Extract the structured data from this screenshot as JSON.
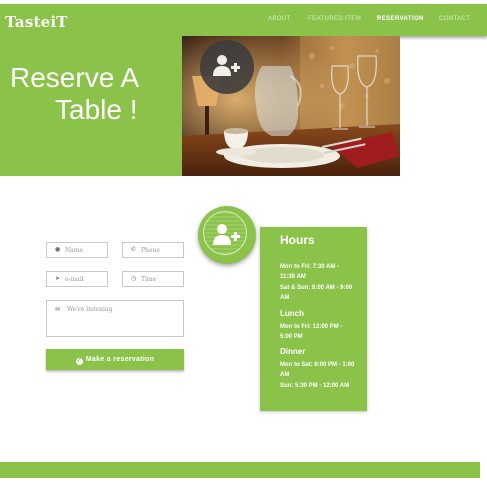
{
  "nav": {
    "brand": "TasteiT",
    "links": [
      "ABOUT",
      "FEATURED ITEM",
      "RESERVATION",
      "CONTACT"
    ]
  },
  "hero": {
    "line1": "Reserve A",
    "line2": "Table !"
  },
  "form": {
    "name_placeholder": "Name",
    "phone_placeholder": "Phone",
    "email_placeholder": "e-mail",
    "time_placeholder": "Time",
    "message_placeholder": "We're listening",
    "submit_label": "Make a reservation"
  },
  "hours": {
    "title": "Hours",
    "general_weekday": "Mon to Fri: 7:30 AM - 11:30 AM",
    "general_weekend": "Sat & Sun: 8:00 AM - 9:00 AM",
    "lunch_title": "Lunch",
    "lunch_times": "Mon to Fri: 12:00 PM - 5:00 PM",
    "dinner_title": "Dinner",
    "dinner_weekday": "Mon to Sat: 6:00 PM - 1:00 AM",
    "dinner_sunday": "Sun: 5:30 PM - 12:00 AM"
  },
  "colors": {
    "accent": "#8bc34a",
    "nav_link": "#dcedc8",
    "badge_dark": "#3c3c3c"
  },
  "icons": [
    "user-plus-icon",
    "user-icon",
    "phone-icon",
    "send-icon",
    "clock-icon",
    "comments-icon",
    "check-circle-icon"
  ]
}
